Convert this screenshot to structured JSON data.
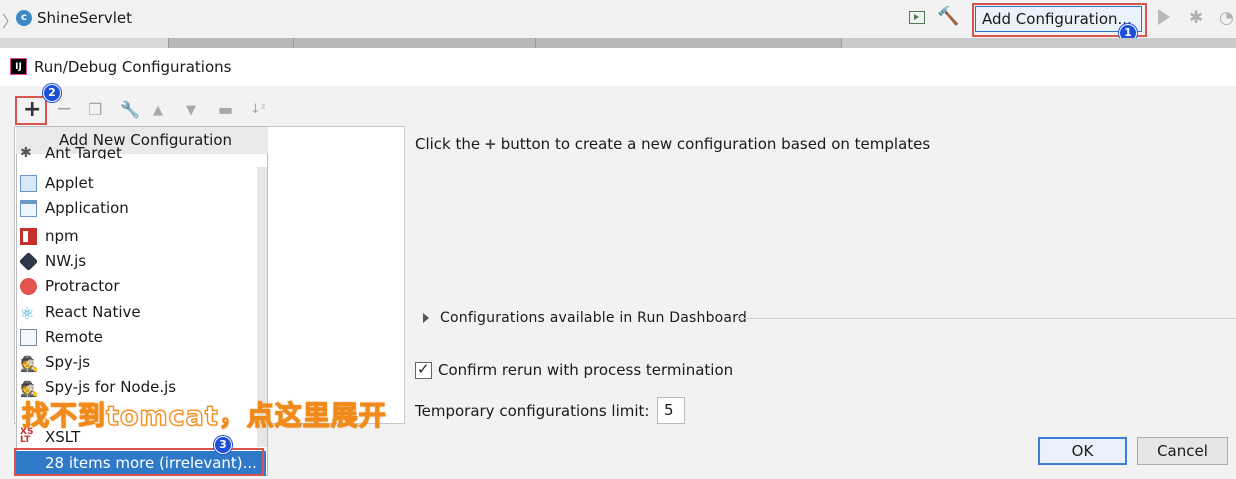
{
  "topbar": {
    "breadcrumb": "ShineServlet",
    "class_icon_letter": "c",
    "add_configuration_label": "Add Configuration...",
    "icons": [
      "terminal-icon",
      "hammer-icon",
      "run-icon",
      "debug-icon",
      "coverage-icon"
    ]
  },
  "dialog": {
    "title": "Run/Debug Configurations",
    "app_icon_text": "IJ",
    "toolbar_icons": [
      "add-icon",
      "remove-icon",
      "copy-icon",
      "wrench-icon",
      "move-up-icon",
      "move-down-icon",
      "folder-icon",
      "sort-icon"
    ],
    "hint_before": "Click the",
    "hint_plus": "+",
    "hint_after": "button to create a new configuration based on templates",
    "dashboard_label": "Configurations available in Run Dashboard",
    "confirm_rerun_label": "Confirm rerun with process termination",
    "confirm_rerun_checked": true,
    "temp_limit_label": "Temporary configurations limit:",
    "temp_limit_value": "5",
    "ok_label": "OK",
    "cancel_label": "Cancel"
  },
  "popup": {
    "header": "Add New Configuration",
    "items": [
      {
        "label": "Ant Target",
        "icon": "ant-icon"
      },
      {
        "label": "Applet",
        "icon": "applet-icon"
      },
      {
        "label": "Application",
        "icon": "application-icon"
      },
      {
        "label": "npm",
        "icon": "npm-icon"
      },
      {
        "label": "NW.js",
        "icon": "nwjs-icon"
      },
      {
        "label": "Protractor",
        "icon": "protractor-icon"
      },
      {
        "label": "React Native",
        "icon": "react-icon"
      },
      {
        "label": "Remote",
        "icon": "remote-icon"
      },
      {
        "label": "Spy-js",
        "icon": "spy-icon"
      },
      {
        "label": "Spy-js for Node.js",
        "icon": "spy-node-icon"
      },
      {
        "label": "XSLT",
        "icon": "xslt-icon"
      }
    ],
    "more_label": "28 items more (irrelevant)..."
  },
  "annotations": {
    "badge1": "1",
    "badge2": "2",
    "badge3": "3",
    "overlay_text": "找不到tomcat，点这里展开",
    "highlight_color": "#d9534f",
    "overlay_color": "#f08a1a"
  }
}
